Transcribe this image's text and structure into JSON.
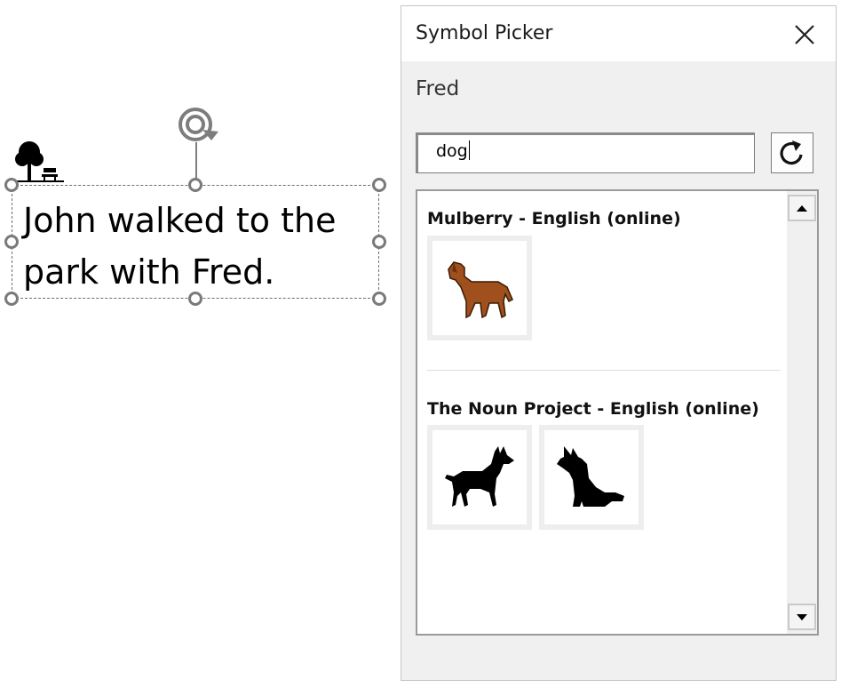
{
  "document": {
    "textbox_line1": "John walked to the",
    "textbox_line2": "park with Fred."
  },
  "picker": {
    "title": "Symbol Picker",
    "subtitle": "Fred",
    "search": {
      "value": "dog"
    },
    "groups": [
      {
        "name": "Mulberry - English (online)",
        "symbols": [
          "dog-brown-icon"
        ]
      },
      {
        "name": "The Noun Project - English (online)",
        "symbols": [
          "dog-standing-silhouette-icon",
          "dog-sitting-silhouette-icon"
        ]
      }
    ]
  },
  "colors": {
    "pane_bg": "#f0f0f0",
    "dog_brown": "#a0501c"
  },
  "icons": {
    "close": "close-icon",
    "refresh": "refresh-icon",
    "rotate": "rotate-icon",
    "park": "park-icon"
  }
}
